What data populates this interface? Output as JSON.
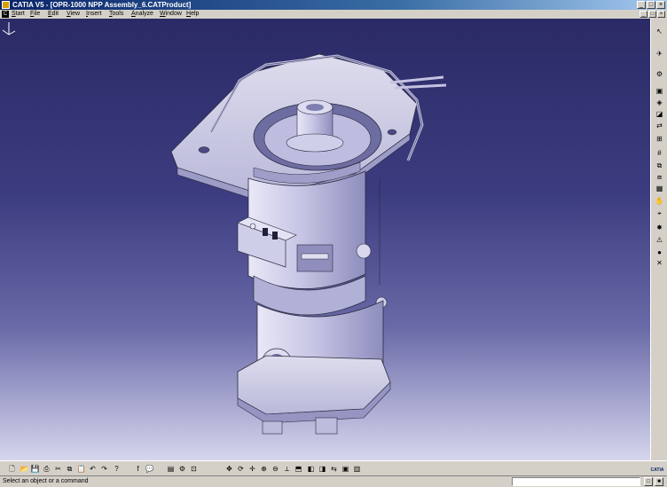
{
  "window": {
    "title": "CATIA V5 - [OPR-1000 NPP Assembly_6.CATProduct]",
    "controls": {
      "minimize": "_",
      "maximize": "□",
      "close": "×"
    }
  },
  "menu": {
    "items": [
      "Start",
      "File",
      "Edit",
      "View",
      "Insert",
      "Tools",
      "Analyze",
      "Window",
      "Help"
    ]
  },
  "viewport": {
    "model": "OPR-1000 NPP Assembly_6",
    "background_top": "#2b2a66",
    "background_bottom": "#d6d6ec",
    "part_color": "#c9c8e6"
  },
  "right_toolbar": {
    "icons": [
      "select-icon",
      "fly-mode-icon",
      "new-component-icon",
      "new-product-icon",
      "new-part-icon",
      "existing-component-icon",
      "replace-component-icon",
      "graph-tree-icon",
      "generate-numbering-icon",
      "multi-instantiation-icon",
      "fast-multi-instantiation-icon",
      "reuse-pattern-icon",
      "manipulation-icon",
      "snap-icon",
      "explode-icon",
      "clash-icon",
      "bulb-icon",
      "hide-show-icon"
    ]
  },
  "bottom_toolbar": {
    "icons": [
      "new-icon",
      "open-icon",
      "save-icon",
      "print-icon",
      "cut-icon",
      "copy-icon",
      "paste-icon",
      "undo-icon",
      "redo-icon",
      "whats-this-icon",
      "formula-icon",
      "comment-icon",
      "catalog-icon",
      "knowledge-icon",
      "fit-all-icon",
      "pan-icon",
      "rotate-icon",
      "zoom-in-icon",
      "zoom-out-icon",
      "normal-view-icon",
      "quick-view-icon",
      "shading-icon",
      "hide-show-icon",
      "swap-icon",
      "render-icon"
    ]
  },
  "status": {
    "message": "Select an object or a command",
    "command_input": ""
  }
}
